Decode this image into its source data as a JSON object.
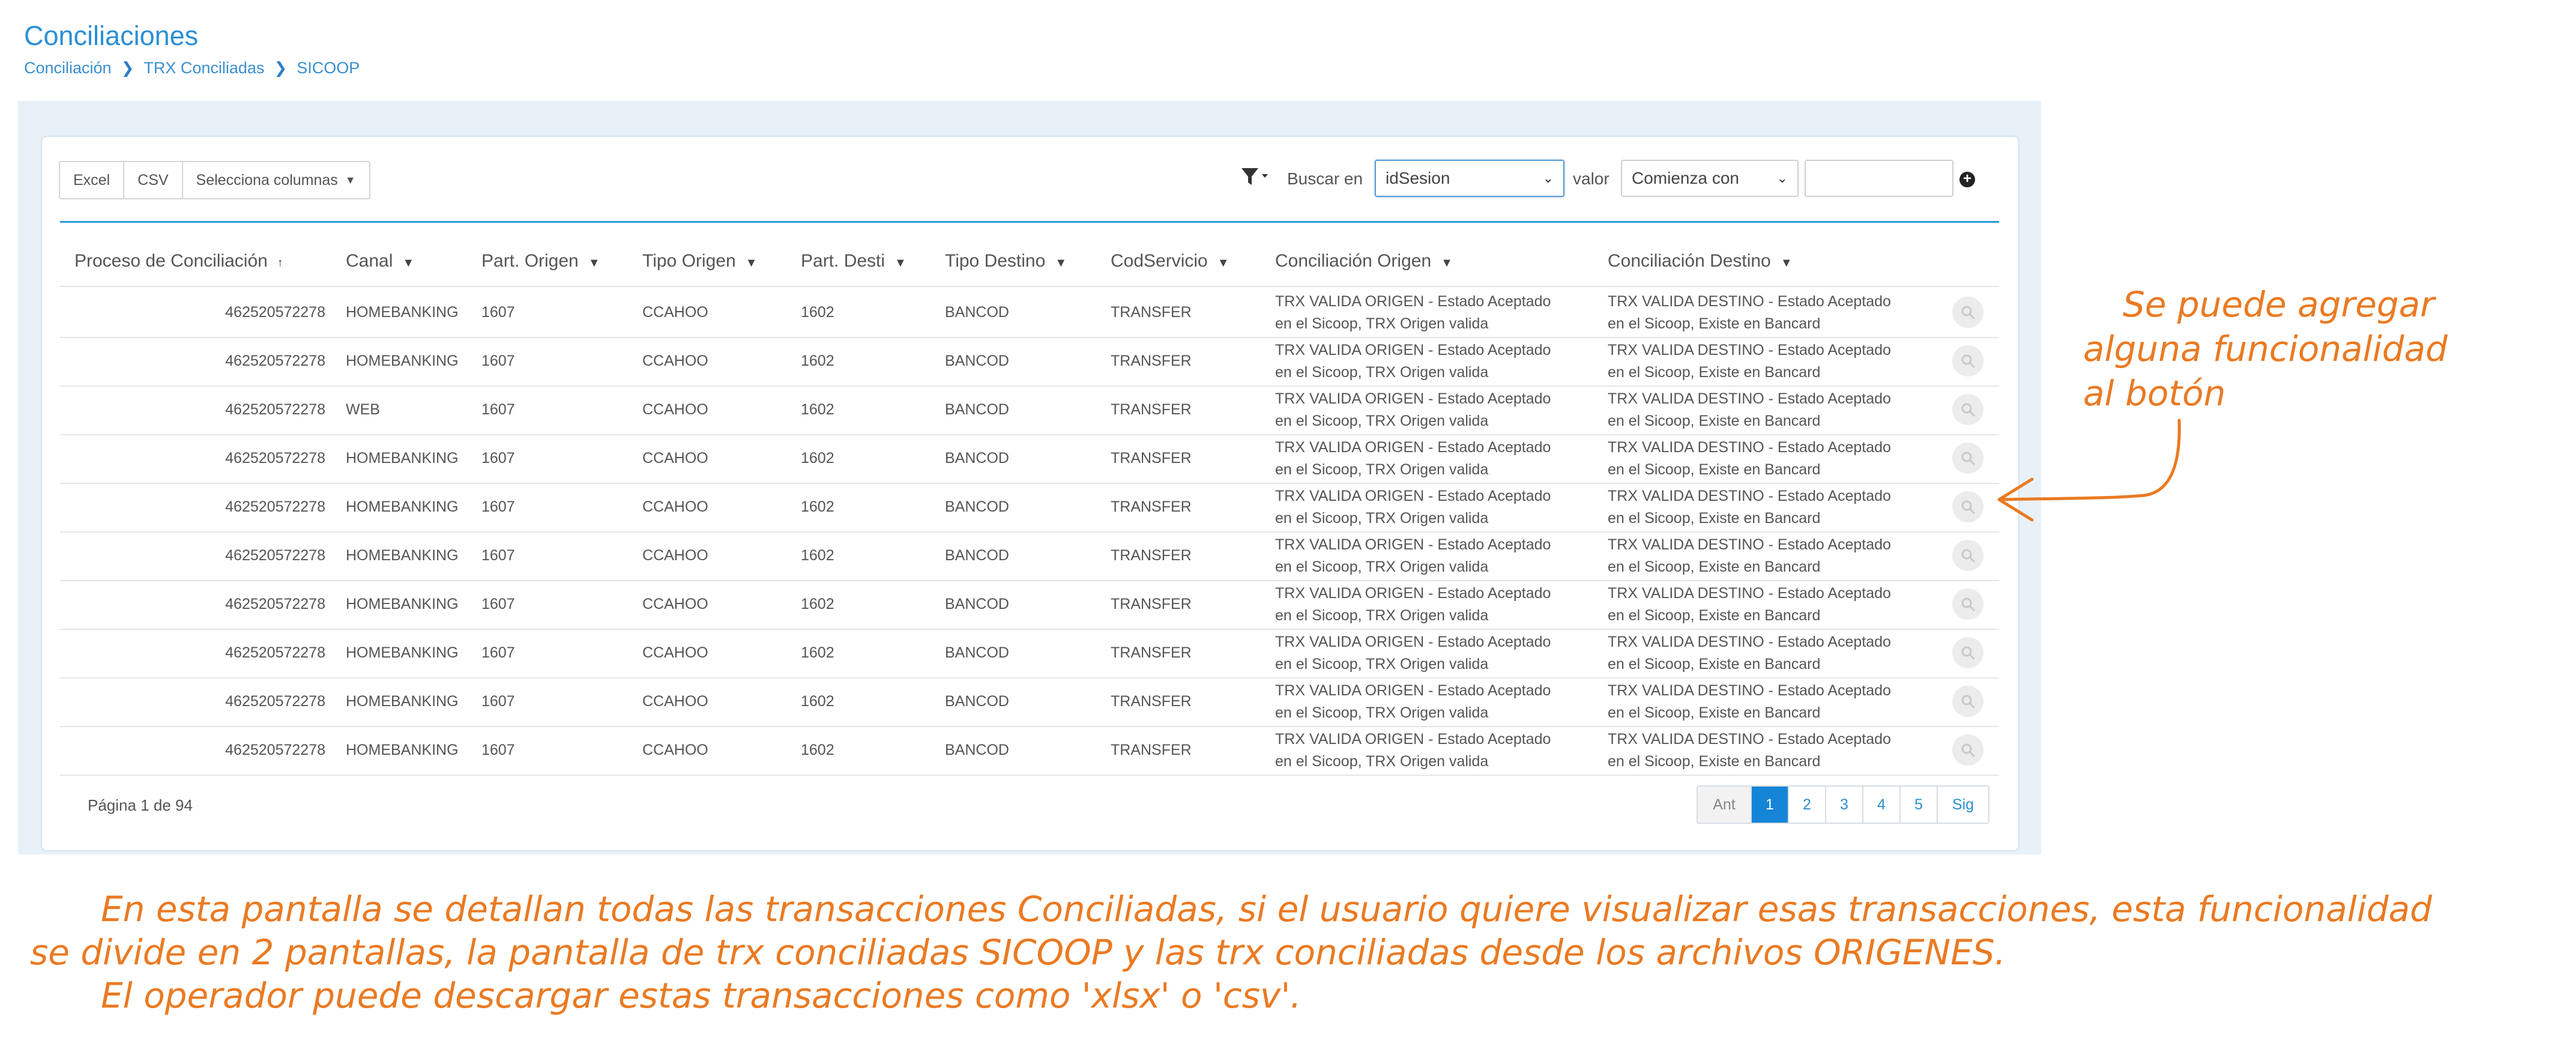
{
  "header": {
    "title": "Conciliaciones",
    "breadcrumb": [
      "Conciliación",
      "TRX Conciliadas",
      "SICOOP"
    ]
  },
  "toolbar": {
    "excel_label": "Excel",
    "csv_label": "CSV",
    "columns_label": "Selecciona columnas",
    "search_in_label": "Buscar en",
    "search_field_value": "idSesion",
    "value_label": "valor",
    "match_mode_value": "Comienza con",
    "search_value": ""
  },
  "table": {
    "columns": [
      "Proceso de Conciliación",
      "Canal",
      "Part. Origen",
      "Tipo Origen",
      "Part. Desti",
      "Tipo Destino",
      "CodServicio",
      "Conciliación Origen",
      "Conciliación Destino"
    ],
    "rows": [
      {
        "proceso": "462520572278",
        "canal": "HOMEBANKING",
        "part_origen": "1607",
        "tipo_origen": "CCAHOO",
        "part_destino": "1602",
        "tipo_destino": "BANCOD",
        "cod_servicio": "TRANSFER",
        "conc_origen_1": "TRX VALIDA ORIGEN - Estado Aceptado",
        "conc_origen_2": "en el Sicoop, TRX Origen valida",
        "conc_destino_1": "TRX VALIDA DESTINO - Estado Aceptado",
        "conc_destino_2": "en el Sicoop, Existe en Bancard"
      },
      {
        "proceso": "462520572278",
        "canal": "HOMEBANKING",
        "part_origen": "1607",
        "tipo_origen": "CCAHOO",
        "part_destino": "1602",
        "tipo_destino": "BANCOD",
        "cod_servicio": "TRANSFER",
        "conc_origen_1": "TRX VALIDA ORIGEN - Estado Aceptado",
        "conc_origen_2": "en el Sicoop, TRX Origen valida",
        "conc_destino_1": "TRX VALIDA DESTINO - Estado Aceptado",
        "conc_destino_2": "en el Sicoop, Existe en Bancard"
      },
      {
        "proceso": "462520572278",
        "canal": "WEB",
        "part_origen": "1607",
        "tipo_origen": "CCAHOO",
        "part_destino": "1602",
        "tipo_destino": "BANCOD",
        "cod_servicio": "TRANSFER",
        "conc_origen_1": "TRX VALIDA ORIGEN - Estado Aceptado",
        "conc_origen_2": "en el Sicoop, TRX Origen valida",
        "conc_destino_1": "TRX VALIDA DESTINO - Estado Aceptado",
        "conc_destino_2": "en el Sicoop, Existe en Bancard"
      },
      {
        "proceso": "462520572278",
        "canal": "HOMEBANKING",
        "part_origen": "1607",
        "tipo_origen": "CCAHOO",
        "part_destino": "1602",
        "tipo_destino": "BANCOD",
        "cod_servicio": "TRANSFER",
        "conc_origen_1": "TRX VALIDA ORIGEN - Estado Aceptado",
        "conc_origen_2": "en el Sicoop, TRX Origen valida",
        "conc_destino_1": "TRX VALIDA DESTINO - Estado Aceptado",
        "conc_destino_2": "en el Sicoop, Existe en Bancard"
      },
      {
        "proceso": "462520572278",
        "canal": "HOMEBANKING",
        "part_origen": "1607",
        "tipo_origen": "CCAHOO",
        "part_destino": "1602",
        "tipo_destino": "BANCOD",
        "cod_servicio": "TRANSFER",
        "conc_origen_1": "TRX VALIDA ORIGEN - Estado Aceptado",
        "conc_origen_2": "en el Sicoop, TRX Origen valida",
        "conc_destino_1": "TRX VALIDA DESTINO - Estado Aceptado",
        "conc_destino_2": "en el Sicoop, Existe en Bancard"
      },
      {
        "proceso": "462520572278",
        "canal": "HOMEBANKING",
        "part_origen": "1607",
        "tipo_origen": "CCAHOO",
        "part_destino": "1602",
        "tipo_destino": "BANCOD",
        "cod_servicio": "TRANSFER",
        "conc_origen_1": "TRX VALIDA ORIGEN - Estado Aceptado",
        "conc_origen_2": "en el Sicoop, TRX Origen valida",
        "conc_destino_1": "TRX VALIDA DESTINO - Estado Aceptado",
        "conc_destino_2": "en el Sicoop, Existe en Bancard"
      },
      {
        "proceso": "462520572278",
        "canal": "HOMEBANKING",
        "part_origen": "1607",
        "tipo_origen": "CCAHOO",
        "part_destino": "1602",
        "tipo_destino": "BANCOD",
        "cod_servicio": "TRANSFER",
        "conc_origen_1": "TRX VALIDA ORIGEN - Estado Aceptado",
        "conc_origen_2": "en el Sicoop, TRX Origen valida",
        "conc_destino_1": "TRX VALIDA DESTINO - Estado Aceptado",
        "conc_destino_2": "en el Sicoop, Existe en Bancard"
      },
      {
        "proceso": "462520572278",
        "canal": "HOMEBANKING",
        "part_origen": "1607",
        "tipo_origen": "CCAHOO",
        "part_destino": "1602",
        "tipo_destino": "BANCOD",
        "cod_servicio": "TRANSFER",
        "conc_origen_1": "TRX VALIDA ORIGEN - Estado Aceptado",
        "conc_origen_2": "en el Sicoop, TRX Origen valida",
        "conc_destino_1": "TRX VALIDA DESTINO - Estado Aceptado",
        "conc_destino_2": "en el Sicoop, Existe en Bancard"
      },
      {
        "proceso": "462520572278",
        "canal": "HOMEBANKING",
        "part_origen": "1607",
        "tipo_origen": "CCAHOO",
        "part_destino": "1602",
        "tipo_destino": "BANCOD",
        "cod_servicio": "TRANSFER",
        "conc_origen_1": "TRX VALIDA ORIGEN - Estado Aceptado",
        "conc_origen_2": "en el Sicoop, TRX Origen valida",
        "conc_destino_1": "TRX VALIDA DESTINO - Estado Aceptado",
        "conc_destino_2": "en el Sicoop, Existe en Bancard"
      },
      {
        "proceso": "462520572278",
        "canal": "HOMEBANKING",
        "part_origen": "1607",
        "tipo_origen": "CCAHOO",
        "part_destino": "1602",
        "tipo_destino": "BANCOD",
        "cod_servicio": "TRANSFER",
        "conc_origen_1": "TRX VALIDA ORIGEN - Estado Aceptado",
        "conc_origen_2": "en el Sicoop, TRX Origen valida",
        "conc_destino_1": "TRX VALIDA DESTINO - Estado Aceptado",
        "conc_destino_2": "en el Sicoop, Existe en Bancard"
      }
    ]
  },
  "footer": {
    "page_info": "Página 1 de 94",
    "pager": {
      "prev": "Ant",
      "pages": [
        "1",
        "2",
        "3",
        "4",
        "5"
      ],
      "next": "Sig"
    }
  },
  "annotations": {
    "right_note": [
      "Se puede agregar",
      "alguna funcionalidad",
      "al botón"
    ],
    "bottom_note": [
      "En esta pantalla se detallan todas las transacciones Conciliadas, si el usuario quiere visualizar esas transacciones, esta funcionalidad",
      "se divide en 2 pantallas, la pantalla de trx conciliadas SICOOP y las trx conciliadas desde los archivos ORIGENES.",
      "El operador puede descargar estas transacciones como 'xlsx' o 'csv'."
    ]
  },
  "colors": {
    "accent": "#1585d8",
    "annotation": "#ea7a22",
    "panel_bg": "#e9f1f8"
  },
  "icons": [
    "chevron-right-icon",
    "caret-down-icon",
    "filter-icon",
    "plus-circle-icon",
    "sort-up-icon",
    "magnifier-icon"
  ]
}
